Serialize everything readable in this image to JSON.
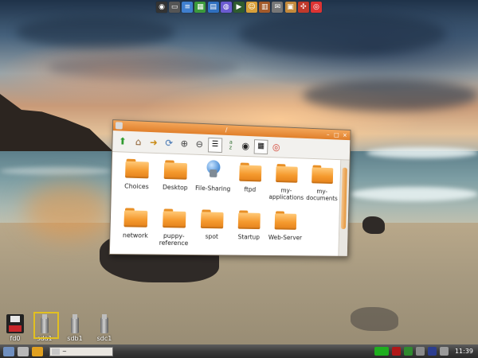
{
  "window": {
    "title": "/",
    "items": [
      {
        "label": "Choices",
        "icon": "folder-icon"
      },
      {
        "label": "Desktop",
        "icon": "folder-icon"
      },
      {
        "label": "File-Sharing",
        "icon": "file-sharing-icon"
      },
      {
        "label": "ftpd",
        "icon": "folder-icon"
      },
      {
        "label": "my-\napplications",
        "icon": "folder-icon"
      },
      {
        "label": "my-\ndocuments",
        "icon": "folder-icon"
      },
      {
        "label": "network",
        "icon": "folder-icon"
      },
      {
        "label": "puppy-\nreference",
        "icon": "folder-icon"
      },
      {
        "label": "spot",
        "icon": "folder-icon"
      },
      {
        "label": "Startup",
        "icon": "folder-icon"
      },
      {
        "label": "Web-Server",
        "icon": "folder-icon"
      }
    ],
    "toolbar": {
      "sort_label": "a\nz"
    }
  },
  "drives": [
    {
      "label": "fd0",
      "icon": "floppy-drive-icon"
    },
    {
      "label": "sda1",
      "icon": "usb-drive-icon",
      "selected": true
    },
    {
      "label": "sdb1",
      "icon": "usb-drive-icon"
    },
    {
      "label": "sdc1",
      "icon": "usb-drive-icon"
    }
  ],
  "taskbar": {
    "task_label": "~",
    "clock": "11:39"
  },
  "colors": {
    "titlebar": "#e88a36",
    "folder": "#f59a2e",
    "taskbar": "#3b3b3b"
  }
}
